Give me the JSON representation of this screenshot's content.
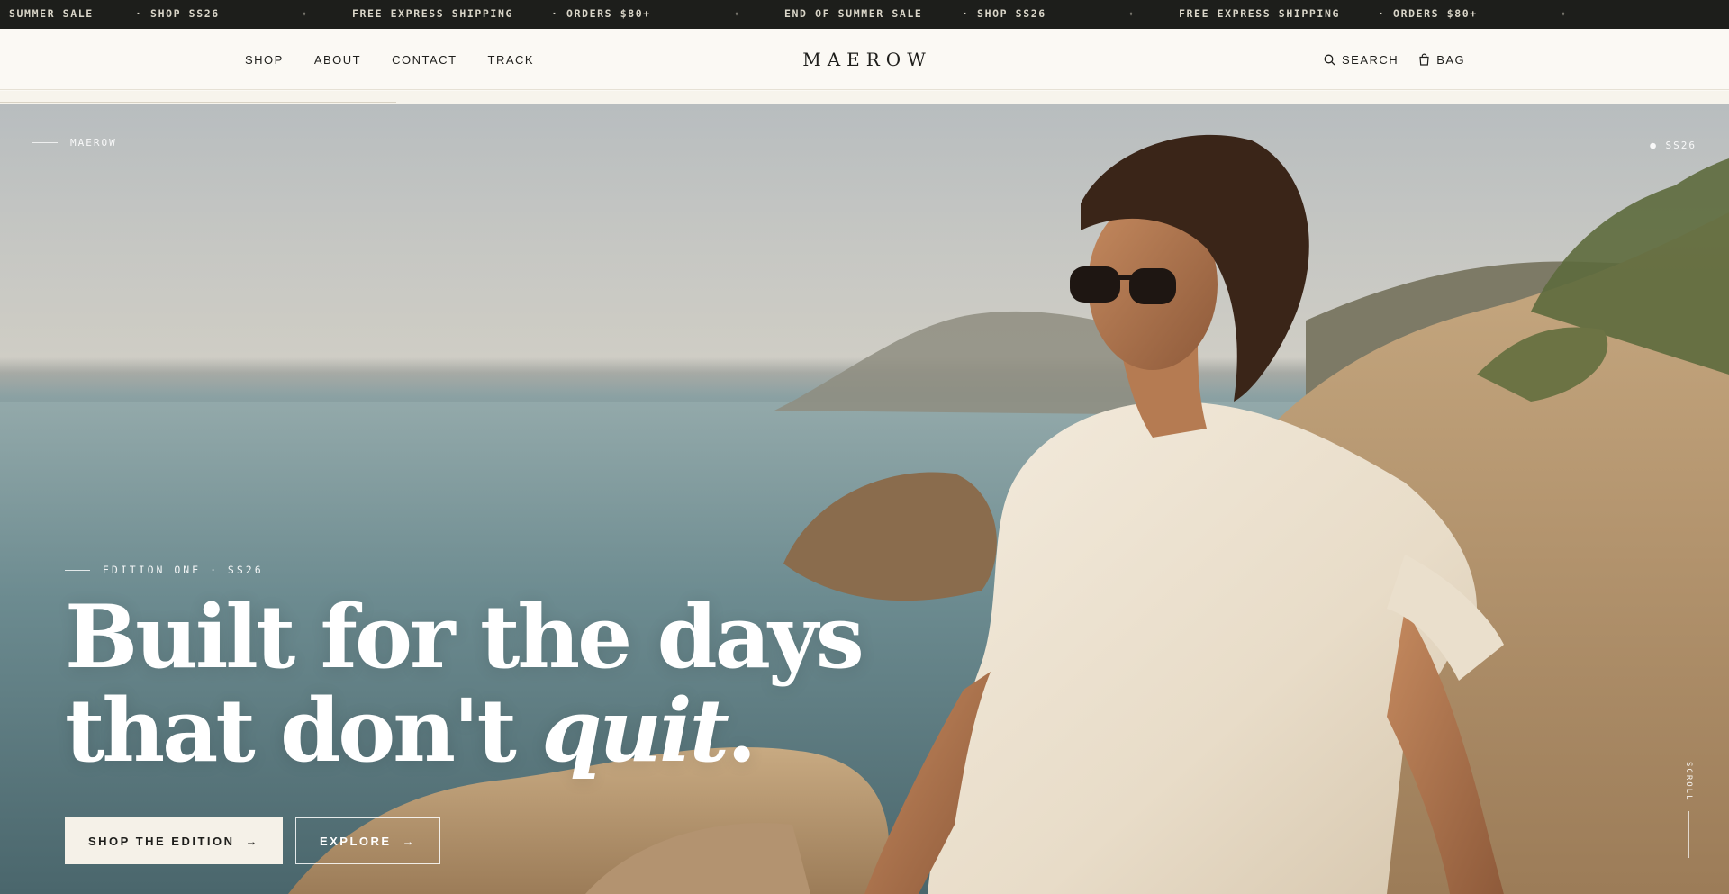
{
  "announcement": {
    "items": [
      "SUMMER SALE",
      "· SHOP SS26",
      "FREE EXPRESS SHIPPING",
      "· ORDERS $80+",
      "END OF SUMMER SALE",
      "· SHOP SS26",
      "FREE EXPRESS SHIPPING",
      "· ORDERS $80+"
    ],
    "separator": "✦"
  },
  "header": {
    "nav_left": [
      "SHOP",
      "ABOUT",
      "CONTACT",
      "TRACK"
    ],
    "logo": "MAEROW",
    "search_label": "SEARCH",
    "bag_label": "BAG"
  },
  "hero": {
    "corner_left": "MAEROW",
    "corner_right": "● SS26",
    "eyebrow": "EDITION ONE · SS26",
    "headline_line1": "Built for the days",
    "headline_line2_plain": "that don't ",
    "headline_line2_italic": "quit",
    "headline_period": ".",
    "primary_cta": "SHOP THE EDITION",
    "secondary_cta": "EXPLORE",
    "cta_arrow": "→",
    "scroll_label": "SCROLL"
  },
  "colors": {
    "ticker_bg": "#1d1e1b",
    "header_bg": "#fbf9f4",
    "ink": "#1c1c1a",
    "cta_fill": "#f5f1e8"
  },
  "icons": [
    "search-icon",
    "bag-icon",
    "sparkle-icon",
    "arrow-right-icon"
  ]
}
